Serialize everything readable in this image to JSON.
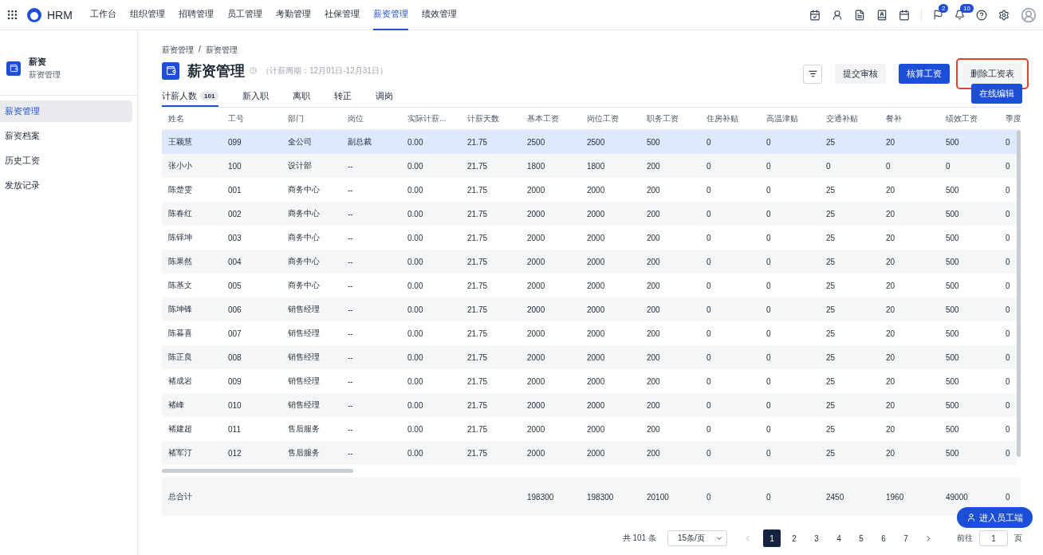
{
  "nav": {
    "brand": "HRM",
    "items": [
      {
        "label": "工作台",
        "selected": false
      },
      {
        "label": "组织管理",
        "selected": false
      },
      {
        "label": "招聘管理",
        "selected": false
      },
      {
        "label": "员工管理",
        "selected": false
      },
      {
        "label": "考勤管理",
        "selected": false
      },
      {
        "label": "社保管理",
        "selected": false
      },
      {
        "label": "薪资管理",
        "selected": true
      },
      {
        "label": "绩效管理",
        "selected": false
      }
    ],
    "notifications": [
      {
        "kind": "flag",
        "badge": "2"
      },
      {
        "kind": "bell",
        "badge": "10"
      }
    ]
  },
  "sidebar": {
    "title": "薪资",
    "subtitle": "薪资管理",
    "items": [
      {
        "label": "薪资管理",
        "selected": true
      },
      {
        "label": "薪资档案",
        "selected": false
      },
      {
        "label": "历史工资",
        "selected": false
      },
      {
        "label": "发放记录",
        "selected": false
      }
    ]
  },
  "breadcrumb": [
    "薪资管理",
    "薪资管理"
  ],
  "breadcrumb_separator": "/",
  "page": {
    "title": "薪资管理",
    "period": "（计薪周期：12月01日-12月31日）"
  },
  "actions": [
    {
      "label": "提交审核",
      "kind": "secondary",
      "highlighted": false
    },
    {
      "label": "核算工资",
      "kind": "primary",
      "highlighted": false
    },
    {
      "label": "删除工资表",
      "kind": "secondary",
      "highlighted": true
    }
  ],
  "tabs": [
    {
      "label": "计薪人数",
      "count": "101",
      "selected": true
    },
    {
      "label": "新入职",
      "selected": false
    },
    {
      "label": "离职",
      "selected": false
    },
    {
      "label": "转正",
      "selected": false
    },
    {
      "label": "调岗",
      "selected": false
    }
  ],
  "edit_button": "在线编辑",
  "table": {
    "columns": [
      "姓名",
      "工号",
      "部门",
      "岗位",
      "实际计薪...",
      "计薪天数",
      "基本工资",
      "岗位工资",
      "职务工资",
      "住房补贴",
      "高温津贴",
      "交通补贴",
      "餐补",
      "绩效工资",
      "季度"
    ],
    "rows": [
      {
        "selected": true,
        "cells": [
          "王颖慧",
          "099",
          "全公司",
          "副总裁",
          "0.00",
          "21.75",
          "2500",
          "2500",
          "500",
          "0",
          "0",
          "25",
          "20",
          "500",
          "0"
        ]
      },
      {
        "selected": false,
        "cells": [
          "张小小",
          "100",
          "设计部",
          "--",
          "0.00",
          "21.75",
          "1800",
          "1800",
          "200",
          "0",
          "0",
          "0",
          "0",
          "0",
          "0"
        ]
      },
      {
        "selected": false,
        "cells": [
          "陈楚雯",
          "001",
          "商务中心",
          "--",
          "0.00",
          "21.75",
          "2000",
          "2000",
          "200",
          "0",
          "0",
          "25",
          "20",
          "500",
          "0"
        ]
      },
      {
        "selected": false,
        "cells": [
          "陈春红",
          "002",
          "商务中心",
          "--",
          "0.00",
          "21.75",
          "2000",
          "2000",
          "200",
          "0",
          "0",
          "25",
          "20",
          "500",
          "0"
        ]
      },
      {
        "selected": false,
        "cells": [
          "陈铎坤",
          "003",
          "商务中心",
          "--",
          "0.00",
          "21.75",
          "2000",
          "2000",
          "200",
          "0",
          "0",
          "25",
          "20",
          "500",
          "0"
        ]
      },
      {
        "selected": false,
        "cells": [
          "陈果然",
          "004",
          "商务中心",
          "--",
          "0.00",
          "21.75",
          "2000",
          "2000",
          "200",
          "0",
          "0",
          "25",
          "20",
          "500",
          "0"
        ]
      },
      {
        "selected": false,
        "cells": [
          "陈基文",
          "005",
          "商务中心",
          "--",
          "0.00",
          "21.75",
          "2000",
          "2000",
          "200",
          "0",
          "0",
          "25",
          "20",
          "500",
          "0"
        ]
      },
      {
        "selected": false,
        "cells": [
          "陈坤锋",
          "006",
          "销售经理",
          "--",
          "0.00",
          "21.75",
          "2000",
          "2000",
          "200",
          "0",
          "0",
          "25",
          "20",
          "500",
          "0"
        ]
      },
      {
        "selected": false,
        "cells": [
          "陈暮喜",
          "007",
          "销售经理",
          "--",
          "0.00",
          "21.75",
          "2000",
          "2000",
          "200",
          "0",
          "0",
          "25",
          "20",
          "500",
          "0"
        ]
      },
      {
        "selected": false,
        "cells": [
          "陈正良",
          "008",
          "销售经理",
          "--",
          "0.00",
          "21.75",
          "2000",
          "2000",
          "200",
          "0",
          "0",
          "25",
          "20",
          "500",
          "0"
        ]
      },
      {
        "selected": false,
        "cells": [
          "褚成岩",
          "009",
          "销售经理",
          "--",
          "0.00",
          "21.75",
          "2000",
          "2000",
          "200",
          "0",
          "0",
          "25",
          "20",
          "500",
          "0"
        ]
      },
      {
        "selected": false,
        "cells": [
          "褚峰",
          "010",
          "销售经理",
          "--",
          "0.00",
          "21.75",
          "2000",
          "2000",
          "200",
          "0",
          "0",
          "25",
          "20",
          "500",
          "0"
        ]
      },
      {
        "selected": false,
        "cells": [
          "褚建超",
          "011",
          "售后服务",
          "--",
          "0.00",
          "21.75",
          "2000",
          "2000",
          "200",
          "0",
          "0",
          "25",
          "20",
          "500",
          "0"
        ]
      },
      {
        "selected": false,
        "cells": [
          "褚军汀",
          "012",
          "售后服务",
          "--",
          "0.00",
          "21.75",
          "2000",
          "2000",
          "200",
          "0",
          "0",
          "25",
          "20",
          "500",
          "0"
        ]
      }
    ],
    "total": {
      "label": "总合计",
      "values": [
        "198300",
        "198300",
        "20100",
        "0",
        "0",
        "2450",
        "1960",
        "49000",
        "0"
      ]
    }
  },
  "pagination": {
    "total": "共 101 条",
    "page_size": "15条/页",
    "pages": [
      {
        "label": "1",
        "selected": true
      },
      {
        "label": "2",
        "selected": false
      },
      {
        "label": "3",
        "selected": false
      },
      {
        "label": "4",
        "selected": false
      },
      {
        "label": "5",
        "selected": false
      },
      {
        "label": "6",
        "selected": false
      },
      {
        "label": "7",
        "selected": false
      }
    ],
    "goto_label": "前往",
    "goto_value": "1",
    "goto_unit": "页"
  },
  "float_button": "进入员工端"
}
